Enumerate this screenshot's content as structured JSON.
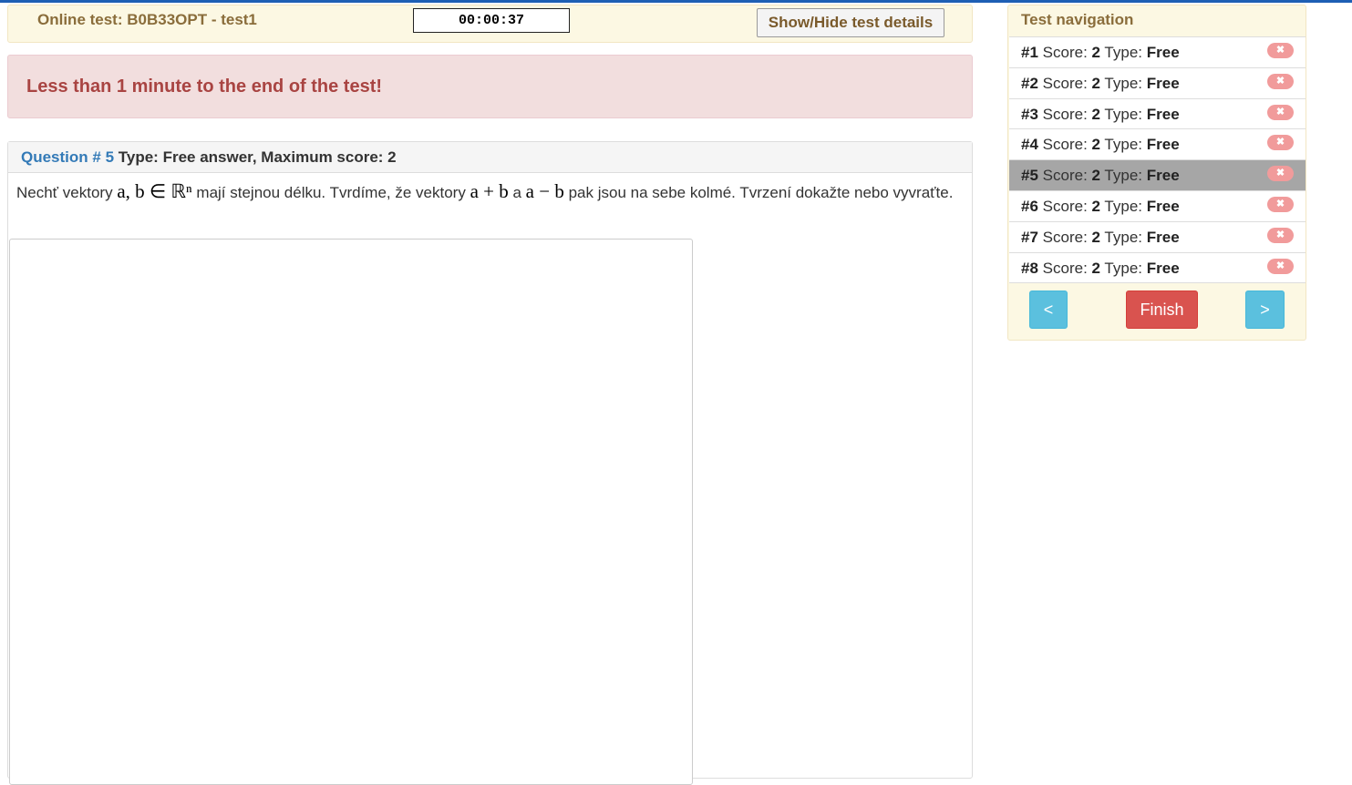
{
  "header": {
    "title": "Online test: B0B33OPT - test1",
    "timer": "00:00:37",
    "details_button": "Show/Hide test details"
  },
  "alert": {
    "text": "Less than 1 minute to the end of the test!"
  },
  "question": {
    "number_label": "Question # 5",
    "type_label": "Type: Free answer, Maximum score: 2",
    "text_part1": "Nechť vektory",
    "math1": "a, b ∈ ℝⁿ",
    "text_part2": "mají stejnou délku. Tvrdíme, že vektory",
    "math2": "a + b",
    "text_part3": "a",
    "math3": "a − b",
    "text_part4": "pak jsou na sebe kolmé. Tvrzení dokažte nebo vyvraťte.",
    "answer_value": ""
  },
  "navigation": {
    "title": "Test navigation",
    "items": [
      {
        "num": "#1",
        "score_label": "Score:",
        "score": "2",
        "type_label": "Type:",
        "type": "Free",
        "icon": "x-badge-icon",
        "active": false
      },
      {
        "num": "#2",
        "score_label": "Score:",
        "score": "2",
        "type_label": "Type:",
        "type": "Free",
        "icon": "x-badge-icon",
        "active": false
      },
      {
        "num": "#3",
        "score_label": "Score:",
        "score": "2",
        "type_label": "Type:",
        "type": "Free",
        "icon": "x-badge-icon",
        "active": false
      },
      {
        "num": "#4",
        "score_label": "Score:",
        "score": "2",
        "type_label": "Type:",
        "type": "Free",
        "icon": "x-badge-icon",
        "active": false
      },
      {
        "num": "#5",
        "score_label": "Score:",
        "score": "2",
        "type_label": "Type:",
        "type": "Free",
        "icon": "x-badge-icon",
        "active": true
      },
      {
        "num": "#6",
        "score_label": "Score:",
        "score": "2",
        "type_label": "Type:",
        "type": "Free",
        "icon": "x-badge-icon",
        "active": false
      },
      {
        "num": "#7",
        "score_label": "Score:",
        "score": "2",
        "type_label": "Type:",
        "type": "Free",
        "icon": "x-badge-icon",
        "active": false
      },
      {
        "num": "#8",
        "score_label": "Score:",
        "score": "2",
        "type_label": "Type:",
        "type": "Free",
        "icon": "x-badge-icon",
        "active": false
      }
    ],
    "prev_label": "<",
    "finish_label": "Finish",
    "next_label": ">"
  },
  "colors": {
    "warning_bg": "#fcf8e3",
    "warning_text": "#8a6d3b",
    "danger_bg": "#f2dede",
    "danger_text": "#a94442",
    "primary_link": "#337ab7",
    "info_button": "#5bc0de",
    "danger_button": "#d9534f"
  }
}
